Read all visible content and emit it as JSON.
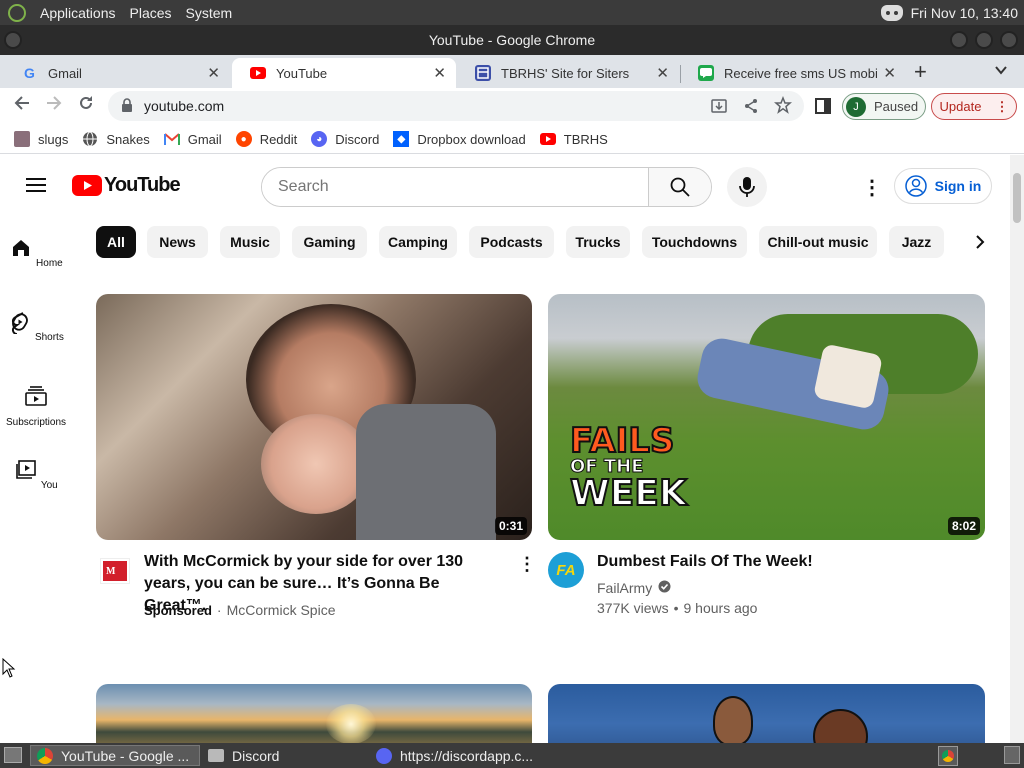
{
  "os": {
    "menu": [
      "Applications",
      "Places",
      "System"
    ],
    "clock": "Fri Nov 10, 13:40"
  },
  "window": {
    "title": "YouTube - Google Chrome"
  },
  "tabs": [
    {
      "label": "Gmail",
      "icon": "gmail-icon"
    },
    {
      "label": "YouTube",
      "icon": "youtube-icon",
      "active": true
    },
    {
      "label": "TBRHS' Site for Siters",
      "icon": "site-icon"
    },
    {
      "label": "Receive free sms US mobile",
      "icon": "sms-icon"
    }
  ],
  "toolbar": {
    "url": "youtube.com",
    "profile_initial": "J",
    "profile_status": "Paused",
    "update_label": "Update"
  },
  "bookmarks": [
    {
      "label": "slugs",
      "icon": "slug-icon"
    },
    {
      "label": "Snakes",
      "icon": "globe-icon"
    },
    {
      "label": "Gmail",
      "icon": "gmail-icon"
    },
    {
      "label": "Reddit",
      "icon": "reddit-icon"
    },
    {
      "label": "Discord",
      "icon": "discord-icon"
    },
    {
      "label": "Dropbox download",
      "icon": "dropbox-icon"
    },
    {
      "label": "TBRHS",
      "icon": "youtube-icon"
    }
  ],
  "youtube": {
    "logo_text": "YouTube",
    "search_placeholder": "Search",
    "signin_label": "Sign in",
    "chips": [
      "All",
      "News",
      "Music",
      "Gaming",
      "Camping",
      "Podcasts",
      "Trucks",
      "Touchdowns",
      "Chill-out music",
      "Jazz"
    ],
    "guide": [
      {
        "label": "Home",
        "icon": "home-icon"
      },
      {
        "label": "Shorts",
        "icon": "shorts-icon"
      },
      {
        "label": "Subscriptions",
        "icon": "subscriptions-icon"
      },
      {
        "label": "You",
        "icon": "you-icon"
      }
    ],
    "videos": [
      {
        "title": "With McCormick by your side for over 130 years, you can be sure… It’s Gonna Be Great™.",
        "duration": "0:31",
        "sponsored": "Sponsored",
        "channel": "McCormick Spice"
      },
      {
        "title": "Dumbest Fails Of The Week!",
        "duration": "8:02",
        "channel": "FailArmy",
        "views": "377K views",
        "age": "9 hours ago",
        "thumb_text": [
          "FAILS",
          "OF THE",
          "WEEK"
        ],
        "avatar_text": "FA"
      }
    ]
  },
  "taskbar": [
    {
      "label": "YouTube - Google ...",
      "icon": "chrome-icon",
      "active": true
    },
    {
      "label": "Discord",
      "icon": "folder-icon"
    },
    {
      "label": "https://discordapp.c...",
      "icon": "discord-icon"
    }
  ],
  "colors": {
    "youtube_red": "#ff0000",
    "signin_blue": "#065fd4",
    "chip_active": "#0f0f0f"
  }
}
